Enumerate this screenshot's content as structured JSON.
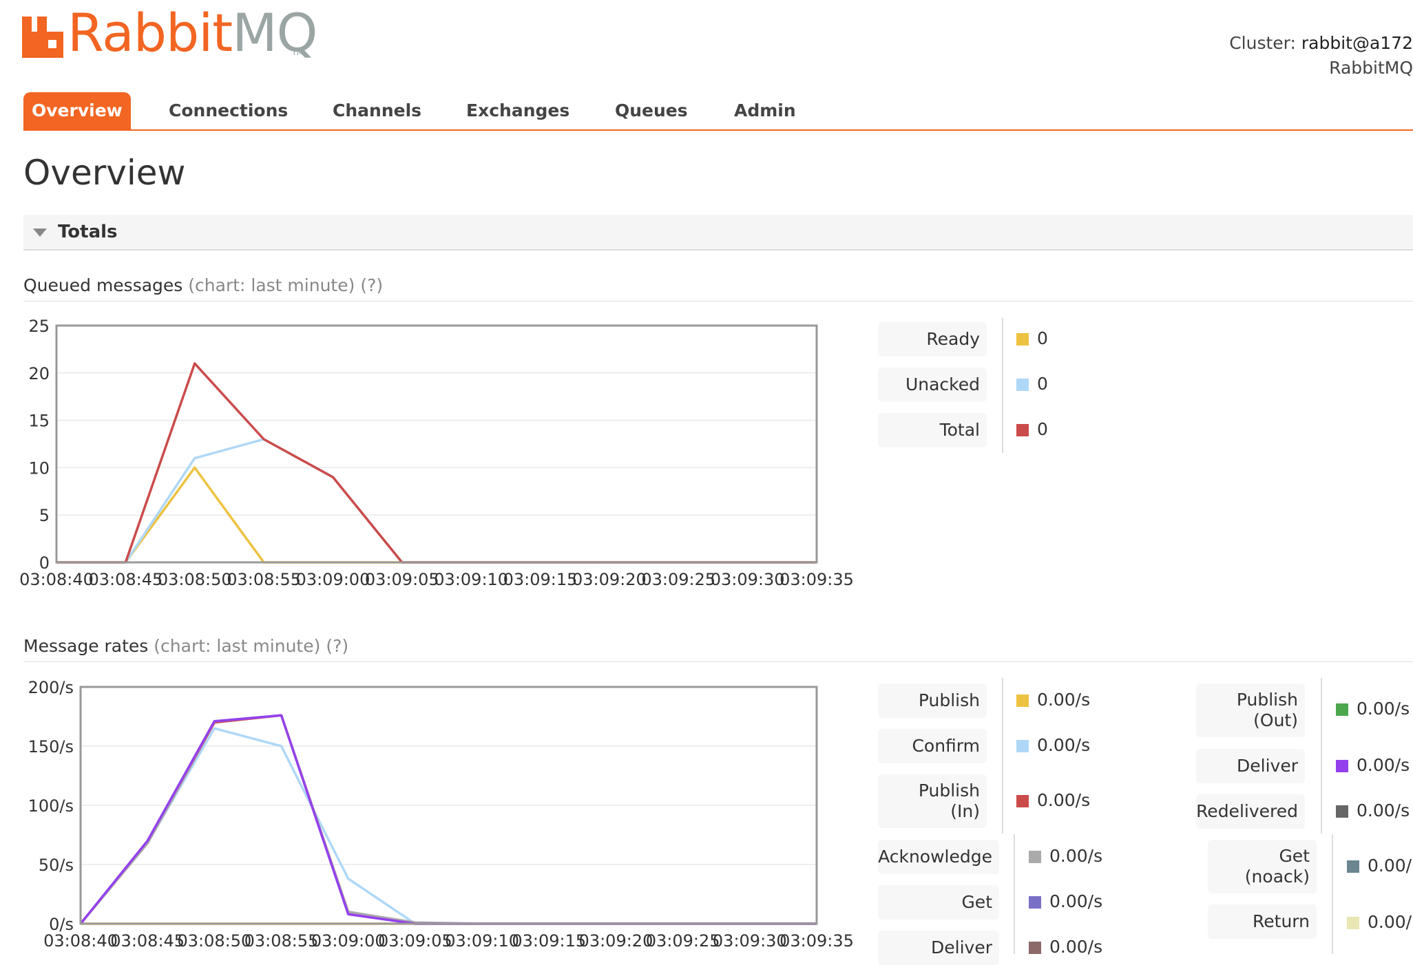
{
  "header": {
    "logo_text_rabbit": "Rabbit",
    "logo_text_mq": "MQ",
    "logo_tm": "TM",
    "cluster_label": "Cluster:",
    "cluster_value": "rabbit@a172",
    "version_text": "RabbitMQ"
  },
  "tabs": [
    {
      "label": "Overview",
      "active": true
    },
    {
      "label": "Connections",
      "active": false
    },
    {
      "label": "Channels",
      "active": false
    },
    {
      "label": "Exchanges",
      "active": false
    },
    {
      "label": "Queues",
      "active": false
    },
    {
      "label": "Admin",
      "active": false
    }
  ],
  "page_title": "Overview",
  "totals_section": {
    "label": "Totals",
    "expanded": true
  },
  "queued_messages": {
    "heading": "Queued messages",
    "chart_note": "(chart: last minute)",
    "help": "(?)",
    "legend": [
      {
        "label": "Ready",
        "value": "0",
        "color": "#edc240"
      },
      {
        "label": "Unacked",
        "value": "0",
        "color": "#afd8f8"
      },
      {
        "label": "Total",
        "value": "0",
        "color": "#cb4b4b"
      }
    ]
  },
  "message_rates": {
    "heading": "Message rates",
    "chart_note": "(chart: last minute)",
    "help": "(?)",
    "legend_col1": [
      {
        "label": "Publish",
        "value": "0.00/s",
        "color": "#edc240"
      },
      {
        "label": "Confirm",
        "value": "0.00/s",
        "color": "#afd8f8"
      },
      {
        "label": "Publish\n(In)",
        "value": "0.00/s",
        "color": "#cb4b4b"
      },
      {
        "label": "Acknowledge",
        "value": "0.00/s",
        "color": "#aaaaaa"
      },
      {
        "label": "Get",
        "value": "0.00/s",
        "color": "#7a6fc7"
      },
      {
        "label": "Deliver",
        "value": "0.00/s",
        "color": "#8c6a6a"
      }
    ],
    "legend_col2": [
      {
        "label": "Publish\n(Out)",
        "value": "0.00/s",
        "color": "#4da74d"
      },
      {
        "label": "Deliver",
        "value": "0.00/s",
        "color": "#9440ed"
      },
      {
        "label": "Redelivered",
        "value": "0.00/s",
        "color": "#666666"
      },
      {
        "label": "Get\n(noack)",
        "value": "0.00/",
        "color": "#6b8591"
      },
      {
        "label": "Return",
        "value": "0.00/",
        "color": "#e8e6b3"
      }
    ]
  },
  "chart_data": [
    {
      "type": "line",
      "x": [
        "03:08:40",
        "03:08:45",
        "03:08:50",
        "03:08:55",
        "03:09:00",
        "03:09:05",
        "03:09:10",
        "03:09:15",
        "03:09:20",
        "03:09:25",
        "03:09:30",
        "03:09:35"
      ],
      "ylim": [
        0,
        25
      ],
      "yticks": [
        "0",
        "5",
        "10",
        "15",
        "20",
        "25"
      ],
      "series": [
        {
          "name": "Ready",
          "color": "#edc240",
          "values": [
            0,
            0,
            10,
            0,
            0,
            0,
            0,
            0,
            0,
            0,
            0,
            0
          ]
        },
        {
          "name": "Unacked",
          "color": "#afd8f8",
          "values": [
            0,
            0,
            11,
            13,
            9,
            0,
            0,
            0,
            0,
            0,
            0,
            0
          ]
        },
        {
          "name": "Total",
          "color": "#cb4b4b",
          "values": [
            0,
            0,
            21,
            13,
            9,
            0,
            0,
            0,
            0,
            0,
            0,
            0
          ]
        }
      ]
    },
    {
      "type": "line",
      "x": [
        "03:08:40",
        "03:08:45",
        "03:08:50",
        "03:08:55",
        "03:09:00",
        "03:09:05",
        "03:09:10",
        "03:09:15",
        "03:09:20",
        "03:09:25",
        "03:09:30",
        "03:09:35"
      ],
      "ylim": [
        0,
        200
      ],
      "yticks": [
        "0/s",
        "50/s",
        "100/s",
        "150/s",
        "200/s"
      ],
      "series": [
        {
          "name": "Publish",
          "color": "#edc240",
          "values": [
            0,
            0,
            0,
            0,
            0,
            0,
            0,
            0,
            0,
            0,
            0,
            0
          ]
        },
        {
          "name": "Confirm",
          "color": "#afd8f8",
          "values": [
            0,
            68,
            165,
            150,
            38,
            0,
            0,
            0,
            0,
            0,
            0,
            0
          ]
        },
        {
          "name": "Publish (In)",
          "color": "#cb4b4b",
          "values": [
            0,
            68,
            170,
            176,
            10,
            0,
            0,
            0,
            0,
            0,
            0,
            0
          ]
        },
        {
          "name": "Acknowledge",
          "color": "#aaaaaa",
          "values": [
            0,
            68,
            171,
            176,
            10,
            1,
            0,
            0,
            0,
            0,
            0,
            0
          ]
        },
        {
          "name": "Deliver",
          "color": "#9440ed",
          "values": [
            0,
            70,
            171,
            176,
            8,
            0,
            0,
            0,
            0,
            0,
            0,
            0
          ]
        }
      ]
    }
  ]
}
